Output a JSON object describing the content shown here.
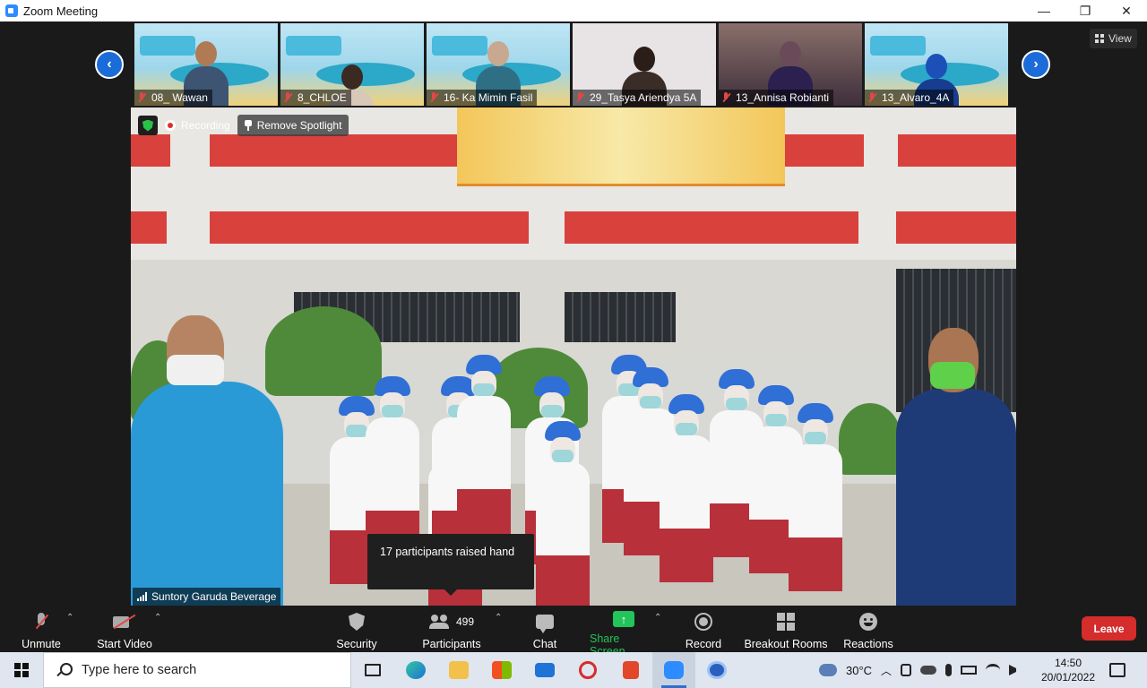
{
  "window": {
    "title": "Zoom Meeting",
    "minimize": "—",
    "restore": "❐",
    "close": "✕"
  },
  "gallery": {
    "prev": "‹",
    "next": "›",
    "view_label": "View",
    "participants": [
      {
        "name": "08_ Wawan",
        "muted": true
      },
      {
        "name": "8_CHLOE",
        "muted": true
      },
      {
        "name": "16- Ka Mimin Fasil",
        "muted": true
      },
      {
        "name": "29_Tasya Ariendya 5A",
        "muted": true
      },
      {
        "name": "13_Annisa Robianti",
        "muted": true
      },
      {
        "name": "13_Alvaro_4A",
        "muted": true
      }
    ]
  },
  "main_video": {
    "recording_label": "Recording",
    "remove_spotlight_label": "Remove Spotlight",
    "speaker_name": "Suntory Garuda Beverage"
  },
  "tooltip": {
    "text": "17 participants raised hand"
  },
  "toolbar": {
    "unmute": "Unmute",
    "start_video": "Start Video",
    "security": "Security",
    "participants": "Participants",
    "participants_count": "499",
    "chat": "Chat",
    "share_screen": "Share Screen",
    "record": "Record",
    "breakout_rooms": "Breakout Rooms",
    "reactions": "Reactions",
    "leave": "Leave",
    "caret": "⌃"
  },
  "taskbar": {
    "search_placeholder": "Type here to search",
    "weather": "30°C",
    "time": "14:50",
    "date": "20/01/2022"
  },
  "colors": {
    "accent_blue": "#2d8cff",
    "leave_red": "#d52c2c",
    "share_green": "#23c45a"
  }
}
